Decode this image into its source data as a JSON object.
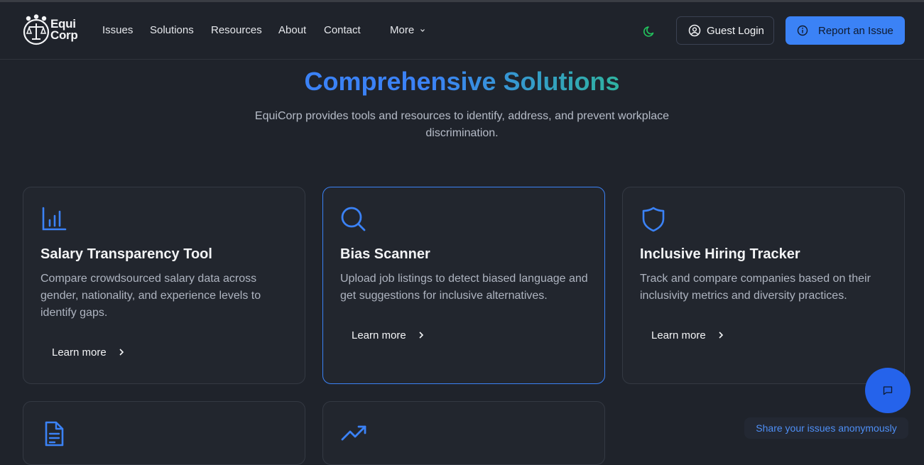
{
  "brand": {
    "name_line1": "Equi",
    "name_line2": "Corp"
  },
  "nav": {
    "items": [
      "Issues",
      "Solutions",
      "Resources",
      "About",
      "Contact"
    ],
    "more_label": "More"
  },
  "header": {
    "guest_login_label": "Guest Login",
    "report_label": "Report an Issue"
  },
  "hero": {
    "title": "Comprehensive Solutions",
    "subtitle": "EquiCorp provides tools and resources to identify, address, and prevent workplace discrimination."
  },
  "cards": [
    {
      "title": "Salary Transparency Tool",
      "description": "Compare crowdsourced salary data across gender, nationality, and experience levels to identify gaps.",
      "link": "Learn more",
      "icon": "bar-chart-icon"
    },
    {
      "title": "Bias Scanner",
      "description": "Upload job listings to detect biased language and get suggestions for inclusive alternatives.",
      "link": "Learn more",
      "icon": "search-icon"
    },
    {
      "title": "Inclusive Hiring Tracker",
      "description": "Track and compare companies based on their inclusivity metrics and diversity practices.",
      "link": "Learn more",
      "icon": "shield-icon"
    },
    {
      "icon": "document-icon"
    },
    {
      "icon": "trending-up-icon"
    }
  ],
  "chat": {
    "tooltip": "Share your issues anonymously",
    "icon": "message-icon"
  },
  "colors": {
    "accent": "#3b82f6",
    "accent_dark": "#2563eb",
    "teal": "#2fb3a0",
    "background": "#1f232b",
    "moon": "#22c55e"
  }
}
